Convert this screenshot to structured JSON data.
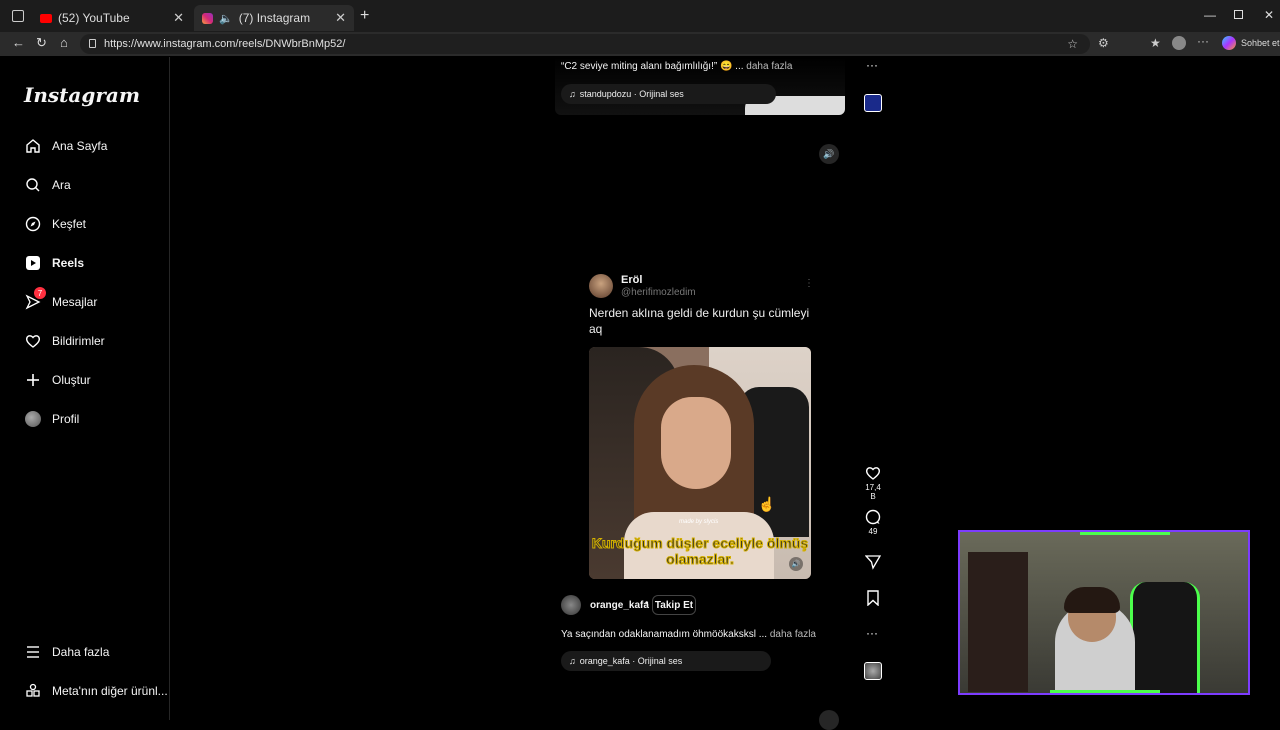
{
  "browser": {
    "tabs": [
      {
        "label": "(52) YouTube",
        "active": false
      },
      {
        "label": "(7) Instagram",
        "active": true
      }
    ],
    "url": "https://www.instagram.com/reels/DNWbrBnMp52/",
    "copilot_label": "Sohbet et"
  },
  "sidebar": {
    "logo": "Instagram",
    "items": [
      {
        "label": "Ana Sayfa",
        "icon": "home-icon"
      },
      {
        "label": "Ara",
        "icon": "search-icon"
      },
      {
        "label": "Keşfet",
        "icon": "compass-icon"
      },
      {
        "label": "Reels",
        "icon": "reels-icon"
      },
      {
        "label": "Mesajlar",
        "icon": "messenger-icon",
        "badge": "7"
      },
      {
        "label": "Bildirimler",
        "icon": "heart-icon"
      },
      {
        "label": "Oluştur",
        "icon": "plus-icon"
      },
      {
        "label": "Profil",
        "icon": "avatar"
      }
    ],
    "more": "Daha fazla",
    "meta": "Meta'nın diğer ürünl..."
  },
  "prev_reel": {
    "caption": "“C2 seviye miting alanı bağımlılığı!” 😄 ...",
    "more": "daha fazla",
    "audio": "standupdozu · Orijinal ses"
  },
  "reel": {
    "tweet_name": "Eröl",
    "tweet_handle": "@herifimozledim",
    "tweet_text": "Nerden aklına geldi de kurdun şu cümleyi aq",
    "watermark": "made by slycis",
    "subtitle": "Kurduğum düşler eceliyle ölmüş olamazlar.",
    "author": "orange_kafa",
    "follow": "Takip Et",
    "caption": "Ya saçından odaklanamadım öhmöökaksksl ...",
    "more": "daha fazla",
    "audio": "orange_kafa · Orijinal ses",
    "likes": "17,4 B",
    "comments": "49"
  },
  "colors": {
    "accent": "#0095f6",
    "badge": "#ff3040",
    "webcam_border": "#7d3cff"
  }
}
